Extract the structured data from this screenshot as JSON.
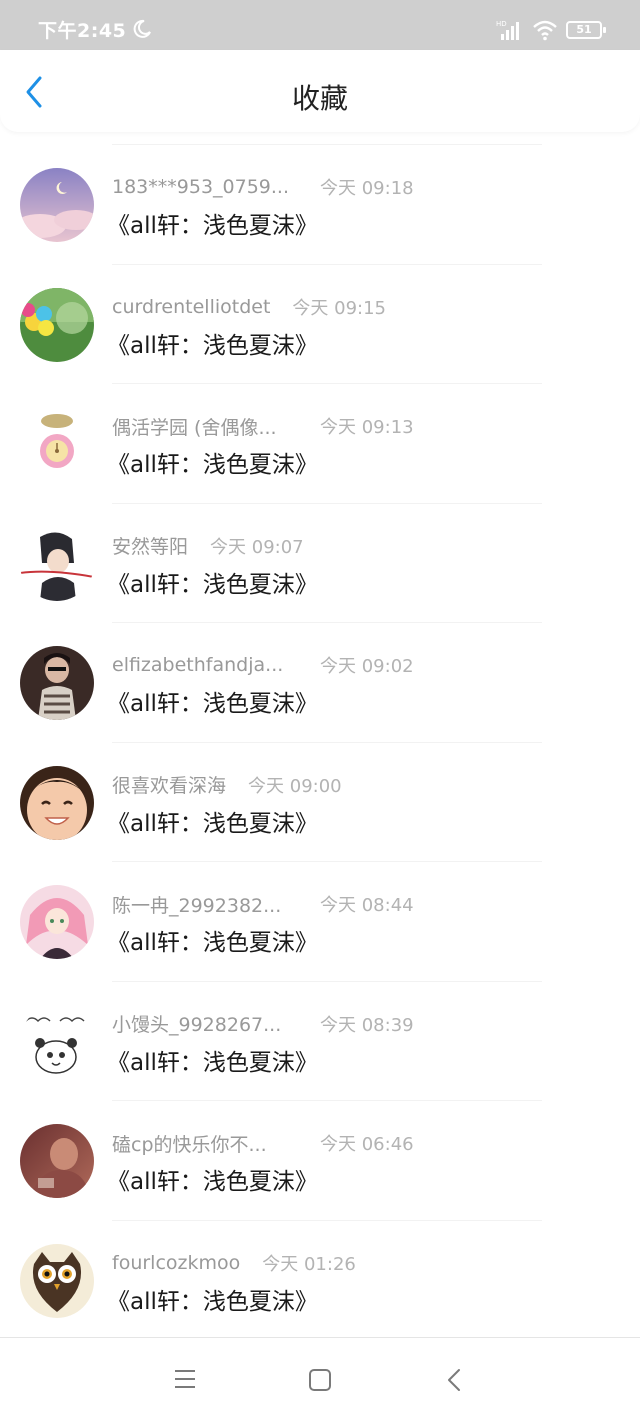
{
  "status_bar": {
    "time": "下午2:45",
    "battery": "51"
  },
  "header": {
    "title": "收藏"
  },
  "items": [
    {
      "user": "183***953_0759...",
      "time": "今天 09:18",
      "title": "《all轩：浅色夏沫》"
    },
    {
      "user": "curdrentelliotdet",
      "time": "今天 09:15",
      "title": "《all轩：浅色夏沫》"
    },
    {
      "user": "偶活学园 (舍偶像...",
      "time": "今天 09:13",
      "title": "《all轩：浅色夏沫》"
    },
    {
      "user": "安然等阳",
      "time": "今天 09:07",
      "title": "《all轩：浅色夏沫》"
    },
    {
      "user": "elfizabethfandja...",
      "time": "今天 09:02",
      "title": "《all轩：浅色夏沫》"
    },
    {
      "user": "很喜欢看深海",
      "time": "今天 09:00",
      "title": "《all轩：浅色夏沫》"
    },
    {
      "user": "陈一冉_2992382...",
      "time": "今天 08:44",
      "title": "《all轩：浅色夏沫》"
    },
    {
      "user": "小馒头_9928267...",
      "time": "今天 08:39",
      "title": "《all轩：浅色夏沫》"
    },
    {
      "user": "磕cp的快乐你不...",
      "time": "今天 06:46",
      "title": "《all轩：浅色夏沫》"
    },
    {
      "user": "fourlcozkmoo",
      "time": "今天 01:26",
      "title": "《all轩：浅色夏沫》"
    }
  ]
}
